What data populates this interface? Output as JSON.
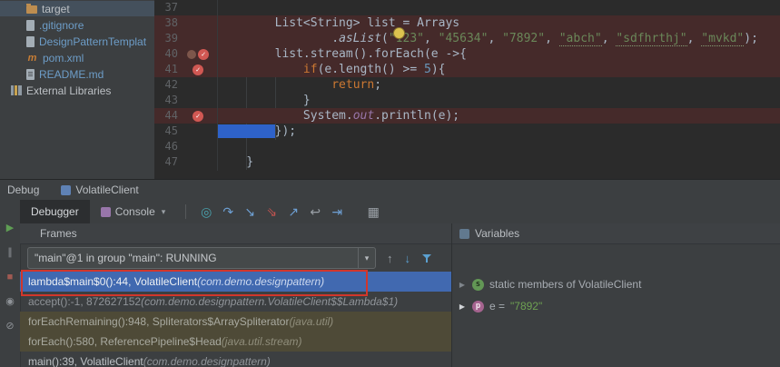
{
  "project_tree": {
    "items": [
      {
        "name": "target",
        "icon": "folder",
        "vcs": false,
        "selected": true,
        "indent": 1
      },
      {
        "name": ".gitignore",
        "icon": "doc",
        "vcs": true,
        "selected": false,
        "indent": 1
      },
      {
        "name": "DesignPatternTemplat",
        "icon": "doc",
        "vcs": true,
        "selected": false,
        "indent": 1
      },
      {
        "name": "pom.xml",
        "icon": "maven",
        "vcs": true,
        "selected": false,
        "indent": 1
      },
      {
        "name": "README.md",
        "icon": "doc-lines",
        "vcs": true,
        "selected": false,
        "indent": 1
      },
      {
        "name": "External Libraries",
        "icon": "libraries",
        "vcs": false,
        "selected": false,
        "indent": 0
      }
    ]
  },
  "editor": {
    "lines": [
      {
        "num": "37",
        "bg": "",
        "icons": [],
        "segs": []
      },
      {
        "num": "38",
        "bg": "bp",
        "icons": [],
        "segs": [
          [
            "p",
            "        List<String> list = Arrays"
          ]
        ]
      },
      {
        "num": "39",
        "bg": "bp",
        "icons": [],
        "segs": [
          [
            "p",
            "                ."
          ],
          [
            "m",
            "asList"
          ],
          [
            "p",
            "("
          ],
          [
            "s",
            "\"123\""
          ],
          [
            "p",
            ", "
          ],
          [
            "s",
            "\"45634\""
          ],
          [
            "p",
            ", "
          ],
          [
            "s",
            "\"7892\""
          ],
          [
            "p",
            ", "
          ],
          [
            "sw",
            "\"abch\""
          ],
          [
            "p",
            ", "
          ],
          [
            "sw",
            "\"sdfhrthj\""
          ],
          [
            "p",
            ", "
          ],
          [
            "sw",
            "\"mvkd\""
          ],
          [
            "p",
            ");"
          ]
        ]
      },
      {
        "num": "40",
        "bg": "bp",
        "icons": [
          "mute",
          "bp"
        ],
        "segs": [
          [
            "p",
            "        list.stream().forEach(e ->{"
          ]
        ]
      },
      {
        "num": "41",
        "bg": "bp",
        "icons": [
          "bp"
        ],
        "segs": [
          [
            "p",
            "            "
          ],
          [
            "k",
            "if"
          ],
          [
            "p",
            "(e.length() >= "
          ],
          [
            "n",
            "5"
          ],
          [
            "p",
            "){"
          ]
        ]
      },
      {
        "num": "42",
        "bg": "",
        "icons": [],
        "segs": [
          [
            "p",
            "                "
          ],
          [
            "k",
            "return"
          ],
          [
            "p",
            ";"
          ]
        ]
      },
      {
        "num": "43",
        "bg": "",
        "icons": [],
        "segs": [
          [
            "p",
            "            }"
          ]
        ]
      },
      {
        "num": "44",
        "bg": "bp",
        "icons": [
          "bp"
        ],
        "segs": [
          [
            "p",
            "            System."
          ],
          [
            "f",
            "out"
          ],
          [
            "p",
            ".println(e);"
          ]
        ]
      },
      {
        "num": "45",
        "bg": "",
        "icons": [],
        "segs": [
          [
            "sel",
            "        "
          ],
          [
            "p",
            "});"
          ]
        ]
      },
      {
        "num": "46",
        "bg": "",
        "icons": [],
        "segs": []
      },
      {
        "num": "47",
        "bg": "",
        "icons": [],
        "segs": [
          [
            "p",
            "    }"
          ]
        ]
      }
    ]
  },
  "debug": {
    "window_title": "Debug",
    "session_tab": "VolatileClient",
    "tabs": [
      {
        "label": "Debugger"
      },
      {
        "label": "Console"
      }
    ],
    "toolbar_icons": [
      {
        "name": "show-execution-point-icon",
        "glyph": "◎",
        "color": "#4aa4b0",
        "gap": false
      },
      {
        "name": "step-over-icon",
        "glyph": "↷",
        "color": "#6ea0d4",
        "gap": false
      },
      {
        "name": "step-into-icon",
        "glyph": "↘",
        "color": "#6ea0d4",
        "gap": false
      },
      {
        "name": "force-step-into-icon",
        "glyph": "⇘",
        "color": "#c75450",
        "gap": false
      },
      {
        "name": "step-out-icon",
        "glyph": "↗",
        "color": "#6ea0d4",
        "gap": false
      },
      {
        "name": "drop-frame-icon",
        "glyph": "↩",
        "color": "#9aa0a6",
        "gap": false
      },
      {
        "name": "run-to-cursor-icon",
        "glyph": "⇥",
        "color": "#6ea0d4",
        "gap": false
      },
      {
        "name": "layout-settings-icon",
        "glyph": "▦",
        "color": "#9aa0a6",
        "gap": true
      }
    ],
    "left_icons": [
      {
        "name": "resume-icon",
        "glyph": "▶",
        "color": "#5f9e54"
      },
      {
        "name": "pause-icon",
        "glyph": "∥",
        "color": "#8f9398"
      },
      {
        "name": "stop-icon",
        "glyph": "■",
        "color": "#a05a52"
      },
      {
        "name": "view-breakpoints-icon",
        "glyph": "◉",
        "color": "#8f9398"
      },
      {
        "name": "mute-breakpoints-icon",
        "glyph": "⊘",
        "color": "#8f9398"
      }
    ],
    "frames": {
      "title": "Frames",
      "thread": "\"main\"@1 in group \"main\": RUNNING",
      "icons": [
        {
          "name": "frame-up-icon",
          "glyph": "↑",
          "color": "#9aa0a6",
          "shape": ""
        },
        {
          "name": "frame-down-icon",
          "glyph": "↓",
          "color": "#5ba0d0",
          "shape": ""
        },
        {
          "name": "filter-frames-icon",
          "glyph": "",
          "color": "#5ba0d0",
          "shape": "funnel"
        }
      ],
      "rows": [
        {
          "main": "lambda$main$0():44, VolatileClient ",
          "loc": "(com.demo.designpattern)",
          "style": "selected"
        },
        {
          "main": "accept():-1, 872627152 ",
          "loc": "(com.demo.designpattern.VolatileClient$$Lambda$1)",
          "style": "dim"
        },
        {
          "main": "forEachRemaining():948, Spliterators$ArraySpliterator ",
          "loc": "(java.util)",
          "style": "lib"
        },
        {
          "main": "forEach():580, ReferencePipeline$Head ",
          "loc": "(java.util.stream)",
          "style": "lib"
        },
        {
          "main": "main():39, VolatileClient ",
          "loc": "(com.demo.designpattern)",
          "style": "normal"
        }
      ]
    },
    "variables": {
      "title": "Variables",
      "rows": [
        {
          "icon": "s",
          "label": "static members of VolatileClient",
          "value": "",
          "chevron": "dim"
        },
        {
          "icon": "p",
          "label": "e = ",
          "value": "\"7892\"",
          "chevron": "bright"
        }
      ]
    }
  }
}
